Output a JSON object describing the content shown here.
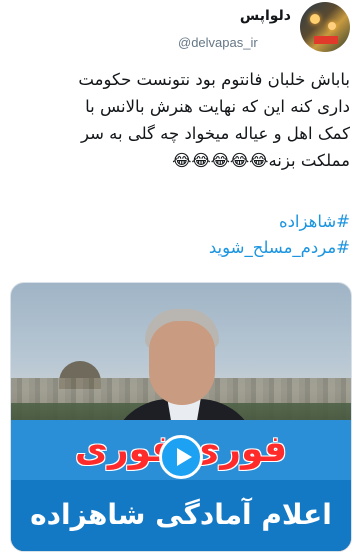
{
  "author": {
    "display_name": "دلواپس",
    "handle": "@delvapas_ir"
  },
  "tweet": {
    "lines": [
      "باباش خلبان فانتوم بود نتونست حکومت",
      "داری کنه این که نهایت هنرش بالانس با",
      "کمک اهل و عیاله میخواد چه گلی به سر",
      "مملکت بزنه😂😂😂😂😂"
    ],
    "hashtags": [
      "#شاهزاده",
      "#مردم_مسلح_شوید"
    ]
  },
  "media": {
    "title": "فوری فوری",
    "subtitle": "اعلام آمادگی شاهزاده",
    "play_icon": "play-icon"
  },
  "colors": {
    "link": "#1b95e0",
    "play_button": "#1da1f2",
    "banner": "#1479c5",
    "title_red": "#ff2a2a"
  }
}
